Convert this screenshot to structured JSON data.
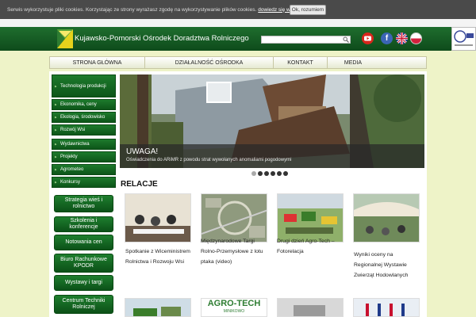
{
  "cookie": {
    "text": "Serwis wykorzystuje pliki cookies. Korzystając ze strony wyrażasz zgodę na wykorzystywanie plików cookies.",
    "more": "dowiedz się więcej.",
    "ok": "Ok, rozumiem"
  },
  "header": {
    "title": "Kujawsko-Pomorski Ośrodek Doradztwa Rolniczego",
    "fb": "f"
  },
  "nav": [
    "Strona główna",
    "Działalność ośrodka",
    "Kontakt",
    "Media"
  ],
  "sidebar": {
    "items": [
      "Technologia produkcji",
      "Ekonomika, ceny",
      "Ekologia, środowisko",
      "Rozwój Wsi",
      "Wydawnictwa",
      "Projekty",
      "Agrometeo",
      "Konkursy"
    ],
    "buttons": [
      "Strategia wieś i rolnictwo",
      "Szkolenia i konferencje",
      "Notowania cen",
      "Biuro Rachunkowe KPODR",
      "Wystawy i targi",
      "Centrum Techniki Rolniczej"
    ]
  },
  "slider": {
    "title": "UWAGA!",
    "subtitle": "Oświadczenia do ARiMR z powodu strat wywołanych anomaliami pogodowymi"
  },
  "relacje": {
    "heading": "RELACJE",
    "items": [
      "Spotkanie z Wiceministrem Rolnictwa i Rozwoju Wsi",
      "Międzynarodowe Targi Rolno-Przemysłowe z lotu ptaka (video)",
      "Drugi dzień Agro-Tech – Fotorelacja",
      "Wyniki oceny na Regionalnej Wystawie Zwierząt Hodowlanych"
    ],
    "logo_text": "AGRO-TECH",
    "logo_sub": "MINIKOWO"
  },
  "colors": {
    "header": "#1f6e2e",
    "accent": "#0d5519",
    "background": "#eef3c8"
  }
}
